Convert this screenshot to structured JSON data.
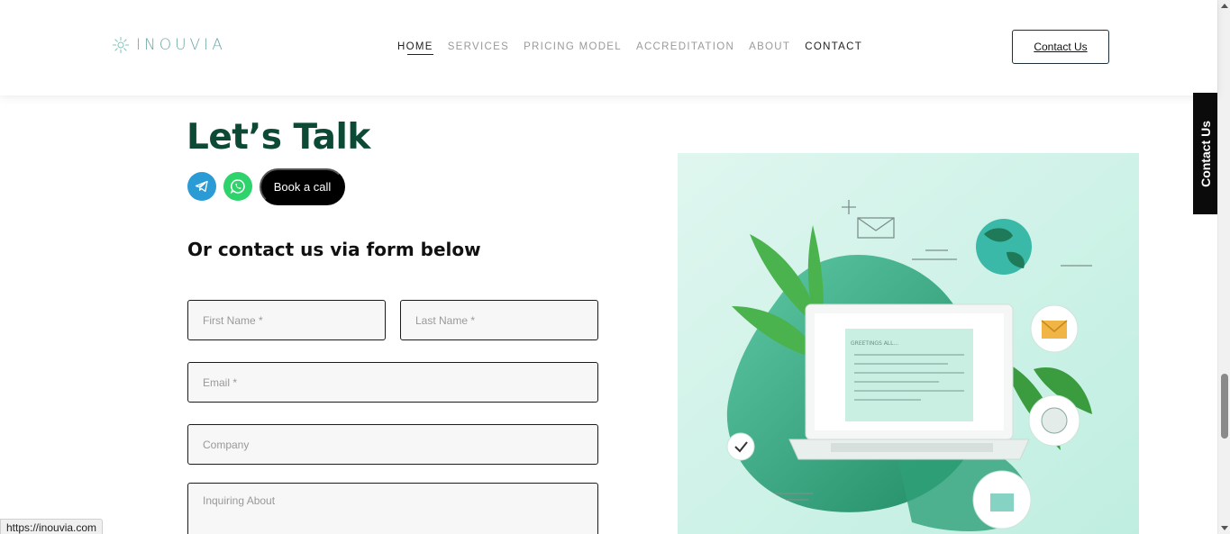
{
  "header": {
    "logo_text": "INOUVIA",
    "nav": [
      {
        "label": "HOME",
        "active": true
      },
      {
        "label": "SERVICES",
        "active": false
      },
      {
        "label": "PRICING MODEL",
        "active": false
      },
      {
        "label": "ACCREDITATION",
        "active": false
      },
      {
        "label": "ABOUT",
        "active": false
      },
      {
        "label": "CONTACT",
        "active": false
      }
    ],
    "contact_button": "Contact Us"
  },
  "side_tab": {
    "label": "Contact Us"
  },
  "main": {
    "heading": "Let’s Talk",
    "book_button": "Book a call",
    "subheading": "Or contact us via form below",
    "form": {
      "first_name_placeholder": "First Name *",
      "last_name_placeholder": "Last Name *",
      "email_placeholder": "Email *",
      "company_placeholder": "Company",
      "inquiring_placeholder": "Inquiring About"
    },
    "illustration": {
      "screen_text": "GREETINGS ALL..."
    }
  },
  "status_bar": {
    "url": "https://inouvia.com"
  },
  "colors": {
    "heading": "#0c4a36",
    "telegram": "#2b9bd6",
    "whatsapp": "#2fd36b",
    "logo": "#6fa9a4"
  },
  "icons": [
    "logo-mark-icon",
    "telegram-icon",
    "whatsapp-icon"
  ]
}
